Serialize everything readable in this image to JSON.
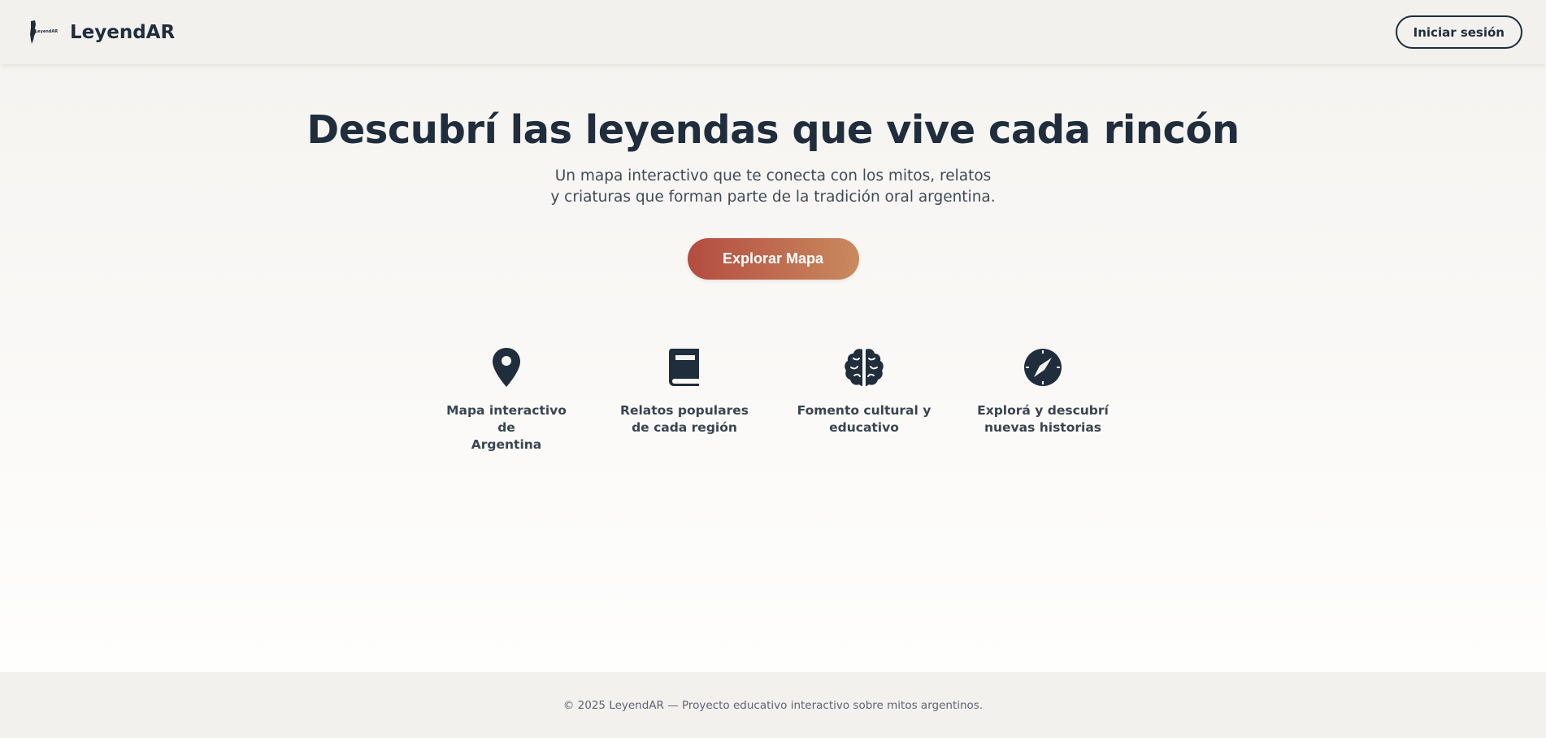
{
  "header": {
    "brand_name": "LeyendAR",
    "logo_text": "LeyendAR",
    "login_label": "Iniciar sesión"
  },
  "hero": {
    "title": "Descubrí las leyendas que vive cada rincón",
    "subtitle_line1": "Un mapa interactivo que te conecta con los mitos, relatos",
    "subtitle_line2": "y criaturas que forman parte de la tradición oral argentina.",
    "cta_label": "Explorar Mapa"
  },
  "features": [
    {
      "icon": "map-pin-icon",
      "line1": "Mapa interactivo de",
      "line2": "Argentina"
    },
    {
      "icon": "book-icon",
      "line1": "Relatos populares",
      "line2": "de cada región"
    },
    {
      "icon": "brain-icon",
      "line1": "Fomento cultural y",
      "line2": "educativo"
    },
    {
      "icon": "compass-icon",
      "line1": "Explorá y descubrí",
      "line2": "nuevas historias"
    }
  ],
  "footer": {
    "text": "© 2025 LeyendAR — Proyecto educativo interactivo sobre mitos argentinos."
  },
  "colors": {
    "primary_text": "#1f2d3d",
    "cta_gradient_start": "#b44c40",
    "cta_gradient_end": "#c98a5e",
    "header_bg": "#f3f1ee"
  }
}
